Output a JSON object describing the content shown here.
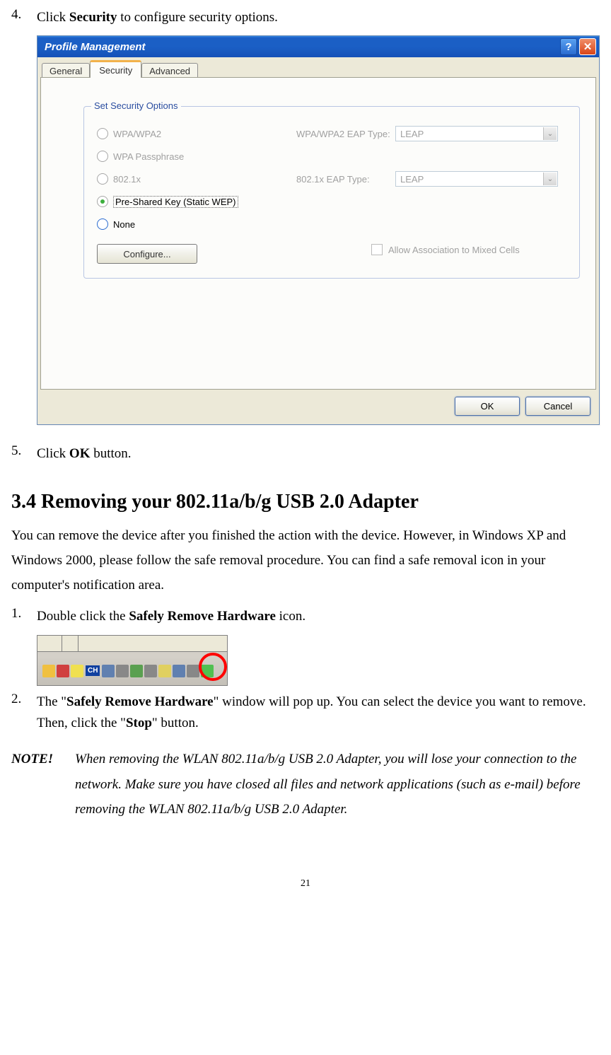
{
  "step4": {
    "num": "4.",
    "pre": "Click ",
    "bold": "Security",
    "post": " to configure security options."
  },
  "dialog": {
    "title": "Profile Management",
    "tabs": {
      "general": "General",
      "security": "Security",
      "advanced": "Advanced"
    },
    "group_legend": "Set Security Options",
    "radios": {
      "wpa": "WPA/WPA2",
      "passphrase": "WPA Passphrase",
      "dot1x": "802.1x",
      "psk": "Pre-Shared Key (Static WEP)",
      "none": "None"
    },
    "eap1_label": "WPA/WPA2 EAP Type:",
    "eap2_label": "802.1x EAP Type:",
    "leap": "LEAP",
    "configure": "Configure...",
    "mixed": "Allow Association to Mixed Cells",
    "ok": "OK",
    "cancel": "Cancel"
  },
  "step5": {
    "num": "5.",
    "pre": "Click ",
    "bold": "OK",
    "post": " button."
  },
  "heading": "3.4 Removing your 802.11a/b/g USB 2.0 Adapter",
  "para1": "You can remove the device after you finished the action with the device. However, in Windows XP and Windows 2000, please follow the safe removal procedure. You can find a safe removal icon in your computer's notification area.",
  "stepA": {
    "num": "1.",
    "pre": "Double click the ",
    "bold": "Safely Remove Hardware",
    "post": " icon."
  },
  "systray": {
    "ch": "CH"
  },
  "stepB": {
    "num": "2.",
    "pre": "The \"",
    "bold1": "Safely Remove Hardware",
    "mid": "\" window will pop up. You can select the device you want to remove. Then, click the \"",
    "bold2": "Stop",
    "post": "\" button."
  },
  "note": {
    "label": "NOTE!",
    "text": "When removing the WLAN 802.11a/b/g USB 2.0 Adapter, you will lose your connection to the network. Make sure you have closed all files and network applications (such as e-mail) before removing the WLAN 802.11a/b/g USB 2.0 Adapter."
  },
  "pagenum": "21"
}
